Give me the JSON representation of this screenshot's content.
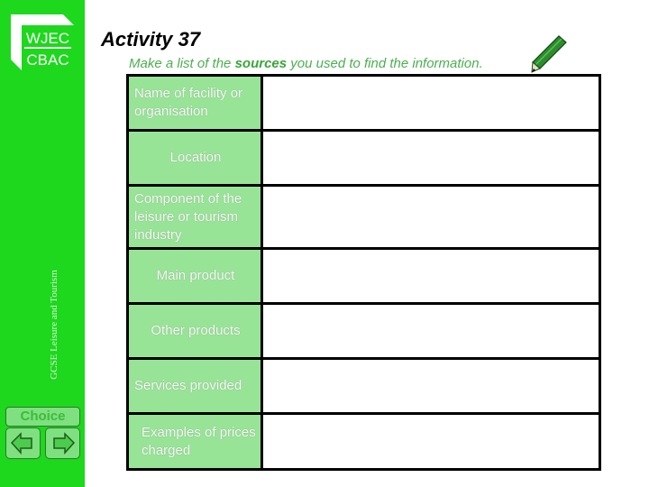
{
  "sidebar": {
    "logo_top": "WJEC",
    "logo_bottom": "CBAC",
    "vertical_caption": "GCSE Leisure and Tourism",
    "choice_label": "Choice",
    "prev_icon": "arrow-left-icon",
    "next_icon": "arrow-right-icon",
    "background_color": "#1dd81d"
  },
  "header": {
    "title": "Activity 37",
    "subtitle_before": "Make a list of the ",
    "subtitle_bold": "sources",
    "subtitle_after": " you used to find the information.",
    "pencil_icon": "pencil-icon"
  },
  "table": {
    "rows": [
      {
        "label": "Name of facility or organisation",
        "value": ""
      },
      {
        "label": "Location",
        "value": ""
      },
      {
        "label": "Component of the leisure or tourism industry",
        "value": ""
      },
      {
        "label": "Main product",
        "value": ""
      },
      {
        "label": "Other products",
        "value": ""
      },
      {
        "label": "Services provided",
        "value": ""
      },
      {
        "label": "Examples of prices charged",
        "value": ""
      }
    ],
    "label_color": "#98e497"
  }
}
